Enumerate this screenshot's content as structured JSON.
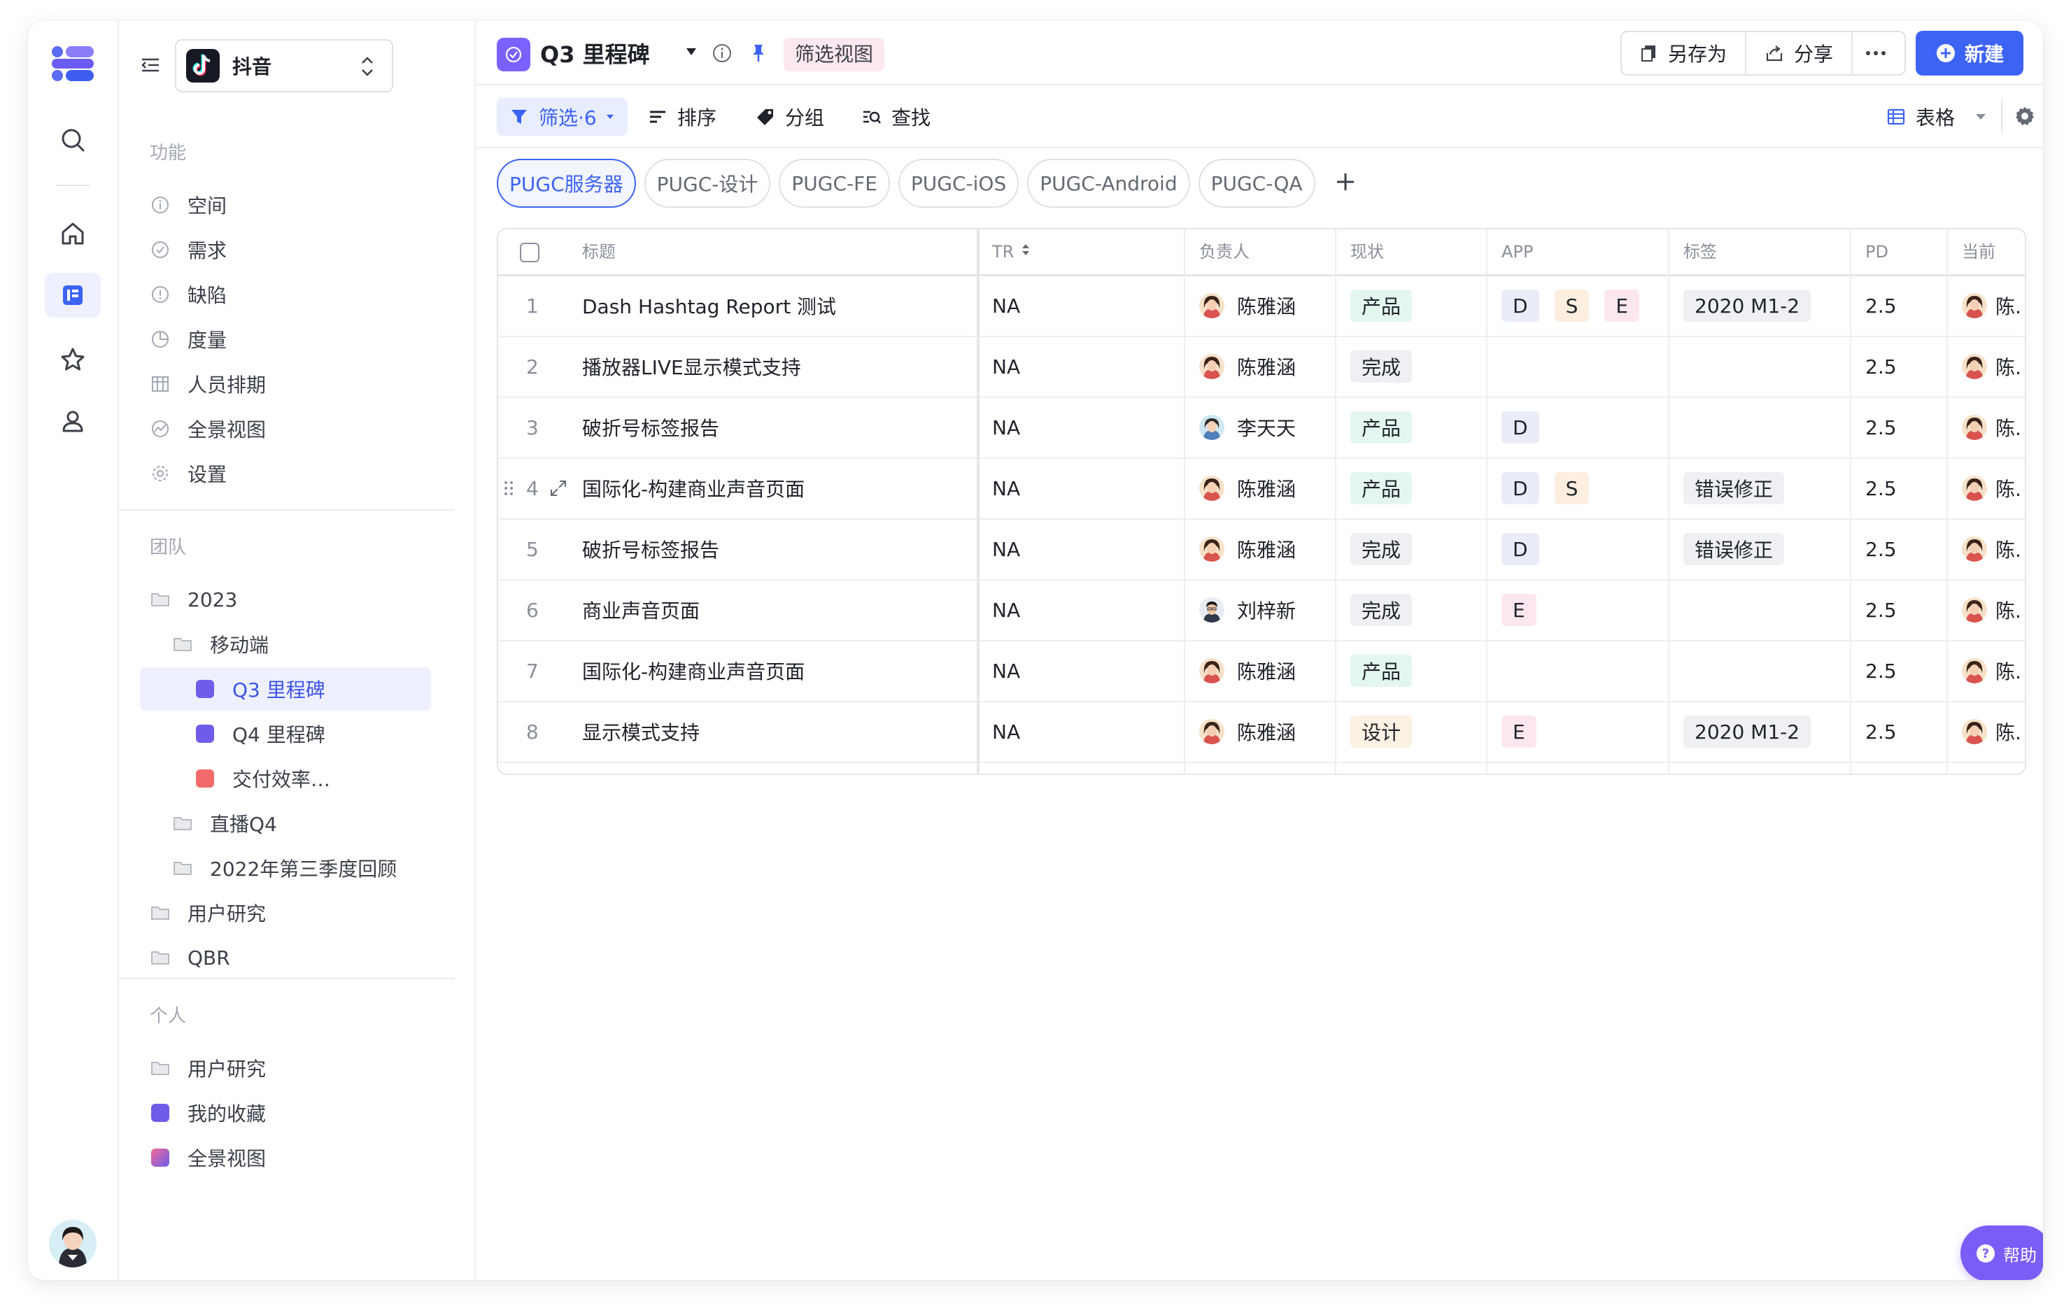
{
  "rail": {
    "items": [
      "search-icon",
      "home-icon",
      "doc-icon",
      "star-icon",
      "user-icon"
    ]
  },
  "sidebar": {
    "app_name": "抖音",
    "sections": {
      "function": "功能",
      "team": "团队",
      "personal": "个人"
    },
    "function_items": [
      "空间",
      "需求",
      "缺陷",
      "度量",
      "人员排期",
      "全景视图",
      "设置"
    ],
    "team_items": [
      "2023",
      "移动端",
      "Q3 里程碑",
      "Q4 里程碑",
      "交付效率…",
      "直播Q4",
      "2022年第三季度回顾",
      "用户研究",
      "QBR"
    ],
    "personal_items": [
      "用户研究",
      "我的收藏",
      "全景视图"
    ],
    "colors": {
      "q3": "#6f5ce8",
      "q4": "#6f5ce8",
      "delivery": "#f36b6b",
      "fav": "#6f5ce8"
    }
  },
  "topbar": {
    "title": "Q3 里程碑",
    "badge": "筛选视图",
    "save_as": "另存为",
    "share": "分享",
    "new": "新建"
  },
  "toolbar": {
    "filter": "筛选·6",
    "sort": "排序",
    "group": "分组",
    "find": "查找",
    "view_mode": "表格"
  },
  "chips": [
    "PUGC服务器",
    "PUGC-设计",
    "PUGC-FE",
    "PUGC-iOS",
    "PUGC-Android",
    "PUGC-QA"
  ],
  "table": {
    "headers": [
      "标题",
      "TR",
      "负责人",
      "现状",
      "APP",
      "标签",
      "PD",
      "当前"
    ],
    "rows": [
      {
        "num": "1",
        "title": "Dash Hashtag Report 测试",
        "tr": "NA",
        "owner": "陈雅涵",
        "status": "产品",
        "apps": [
          "D",
          "S",
          "E"
        ],
        "label": "2020 M1-2",
        "pd": "2.5",
        "cur": "陈."
      },
      {
        "num": "2",
        "title": "播放器LIVE显示模式支持",
        "tr": "NA",
        "owner": "陈雅涵",
        "status": "完成",
        "apps": [],
        "label": "",
        "pd": "2.5",
        "cur": "陈."
      },
      {
        "num": "3",
        "title": "破折号标签报告",
        "tr": "NA",
        "owner": "李天天",
        "status": "产品",
        "apps": [
          "D"
        ],
        "label": "",
        "pd": "2.5",
        "cur": "陈."
      },
      {
        "num": "4",
        "title": "国际化-构建商业声音页面",
        "tr": "NA",
        "owner": "陈雅涵",
        "status": "产品",
        "apps": [
          "D",
          "S"
        ],
        "label": "错误修正",
        "pd": "2.5",
        "cur": "陈."
      },
      {
        "num": "5",
        "title": "破折号标签报告",
        "tr": "NA",
        "owner": "陈雅涵",
        "status": "完成",
        "apps": [
          "D"
        ],
        "label": "错误修正",
        "pd": "2.5",
        "cur": "陈."
      },
      {
        "num": "6",
        "title": "商业声音页面",
        "tr": "NA",
        "owner": "刘梓新",
        "status": "完成",
        "apps": [
          "E"
        ],
        "label": "",
        "pd": "2.5",
        "cur": "陈."
      },
      {
        "num": "7",
        "title": "国际化-构建商业声音页面",
        "tr": "NA",
        "owner": "陈雅涵",
        "status": "产品",
        "apps": [],
        "label": "",
        "pd": "2.5",
        "cur": "陈."
      },
      {
        "num": "8",
        "title": "显示模式支持",
        "tr": "NA",
        "owner": "陈雅涵",
        "status": "设计",
        "apps": [
          "E"
        ],
        "label": "2020 M1-2",
        "pd": "2.5",
        "cur": "陈."
      }
    ]
  },
  "help": "帮助",
  "accent": "#3d63f5"
}
